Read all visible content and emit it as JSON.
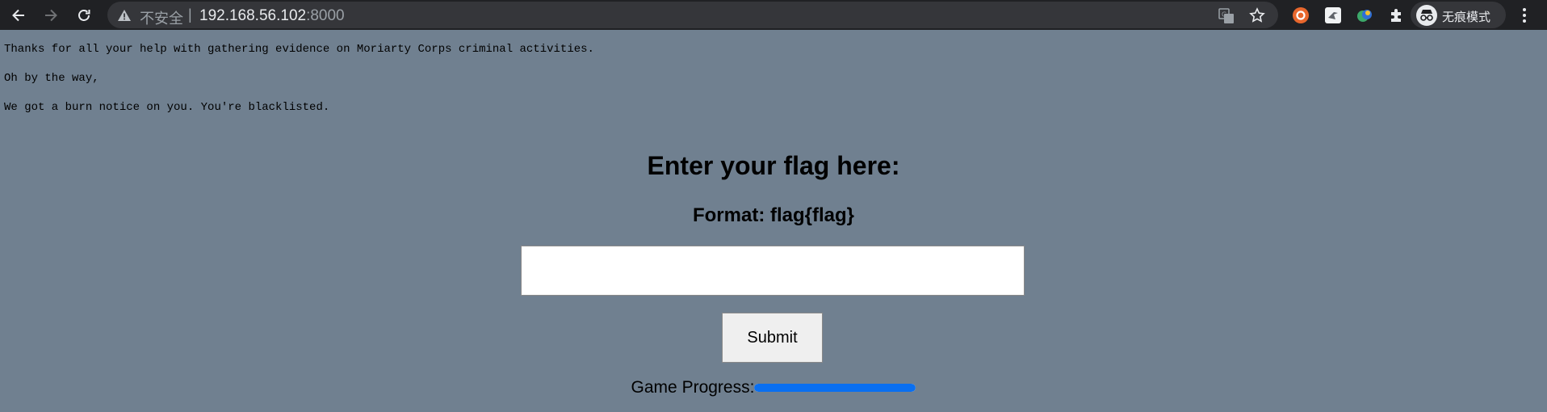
{
  "browser": {
    "address_bar": {
      "security_label": "不安全",
      "separator": "|",
      "host": "192.168.56.102",
      "port": ":8000"
    },
    "profile": {
      "label": "无痕模式"
    },
    "colors": {
      "chrome_bg": "#202124",
      "omnibox_bg": "#35363a"
    }
  },
  "page": {
    "messages": [
      "Thanks for all your help with gathering evidence on Moriarty Corps criminal activities.",
      "Oh by the way,",
      "We got a burn notice on you. You're blacklisted."
    ],
    "heading": "Enter your flag here:",
    "format_hint": "Format: flag{flag}",
    "flag_input": {
      "value": "",
      "placeholder": ""
    },
    "submit_label": "Submit",
    "progress": {
      "label": "Game Progress:",
      "value": 1.0,
      "color": "#0a6ff0"
    },
    "background_color": "#708090"
  }
}
